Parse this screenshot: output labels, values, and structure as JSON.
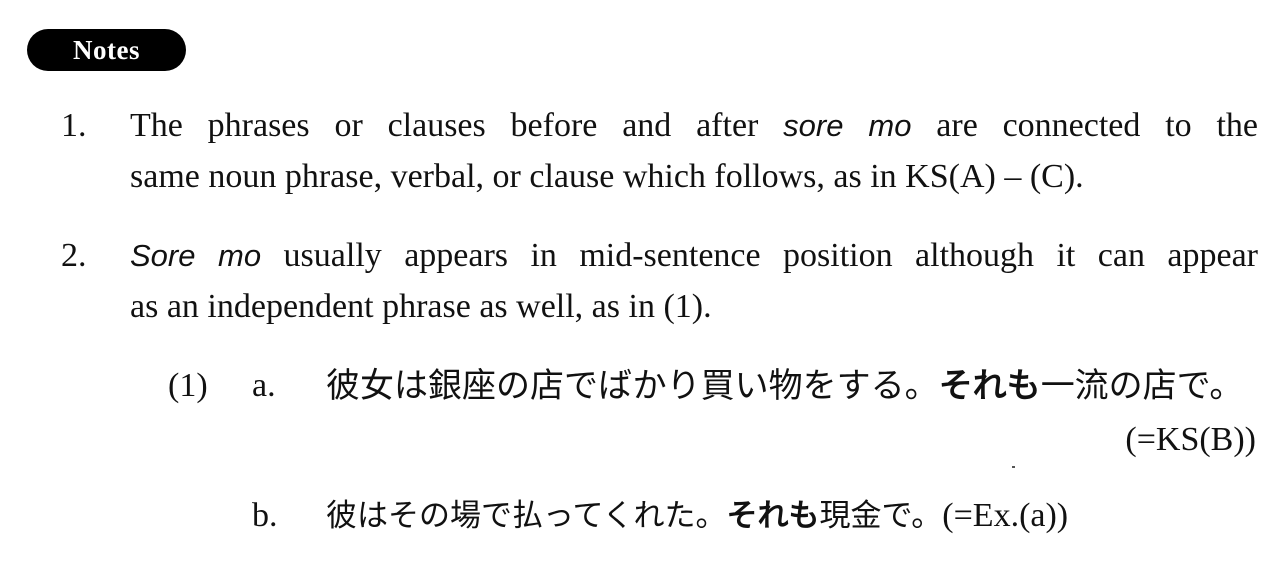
{
  "section_badge": "Notes",
  "notes": [
    {
      "number": "1.",
      "line1_a": "The phrases or clauses before and after ",
      "line1_term": "sore mo",
      "line1_b": " are connected to the",
      "line2": "same noun phrase, verbal, or clause which follows, as in KS(A) – (C)."
    },
    {
      "number": "2.",
      "line1_term": "Sore mo",
      "line1_b": " usually appears in mid-sentence position although it can appear",
      "line2": "as an independent phrase as well, as in (1)."
    }
  ],
  "example_group": {
    "number": "(1)",
    "items": [
      {
        "letter": "a.",
        "jp_before": "彼女は銀座の店でばかり買い物をする。",
        "jp_bold": "それも",
        "jp_after": "一流の店で。",
        "reference": "(=KS(B))"
      },
      {
        "letter": "b.",
        "jp_before": "彼はその場で払ってくれた。",
        "jp_bold": "それも",
        "jp_after": "現金で。",
        "reference": "(=Ex.(a))"
      }
    ]
  }
}
